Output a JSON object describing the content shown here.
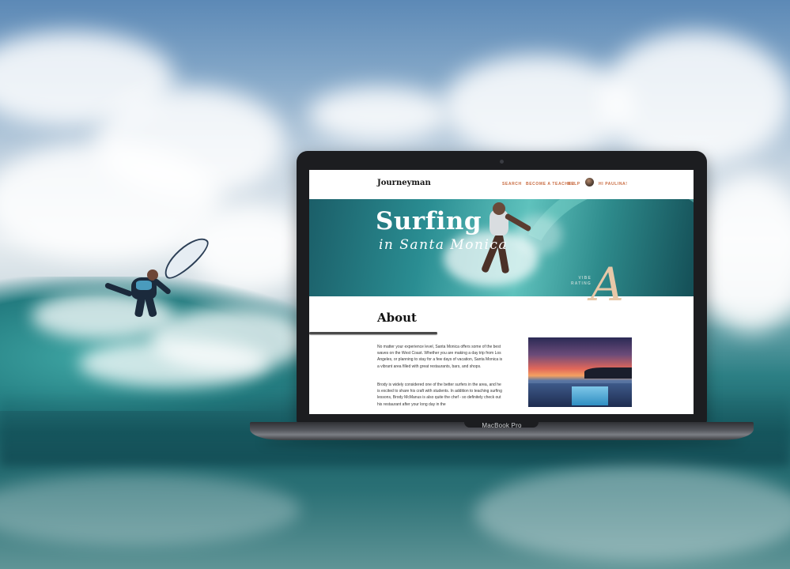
{
  "device": {
    "model": "MacBook Pro"
  },
  "site": {
    "logo": "Journeyman",
    "nav": {
      "links": [
        "SEARCH",
        "BECOME A TEACHER",
        "HELP"
      ],
      "greeting": "HI PAULINA!"
    },
    "hero": {
      "title": "Surfing",
      "subtitle": "in Santa Monica",
      "rating_label_line1": "VIBE",
      "rating_label_line2": "RATING",
      "rating_grade": "A"
    },
    "about": {
      "title": "About",
      "paragraph1": "No matter your experience level, Santa Monica offers some of the best waves on the West Coast. Whether you are making a day trip from Los Angeles, or planning to stay for a few days of vacation, Santa Monica is a vibrant area filled with great restaurants, bars, and shops.",
      "paragraph2": "Brody is widely considered one of the better surfers in the area, and he is excited to share his craft with students. In addition to teaching surfing lessons, Brody McManus is also quite the chef - so definitely check out his restaurant after your long day in the"
    }
  },
  "colors": {
    "accent": "#c86b41",
    "rating": "#e7c8a8"
  }
}
